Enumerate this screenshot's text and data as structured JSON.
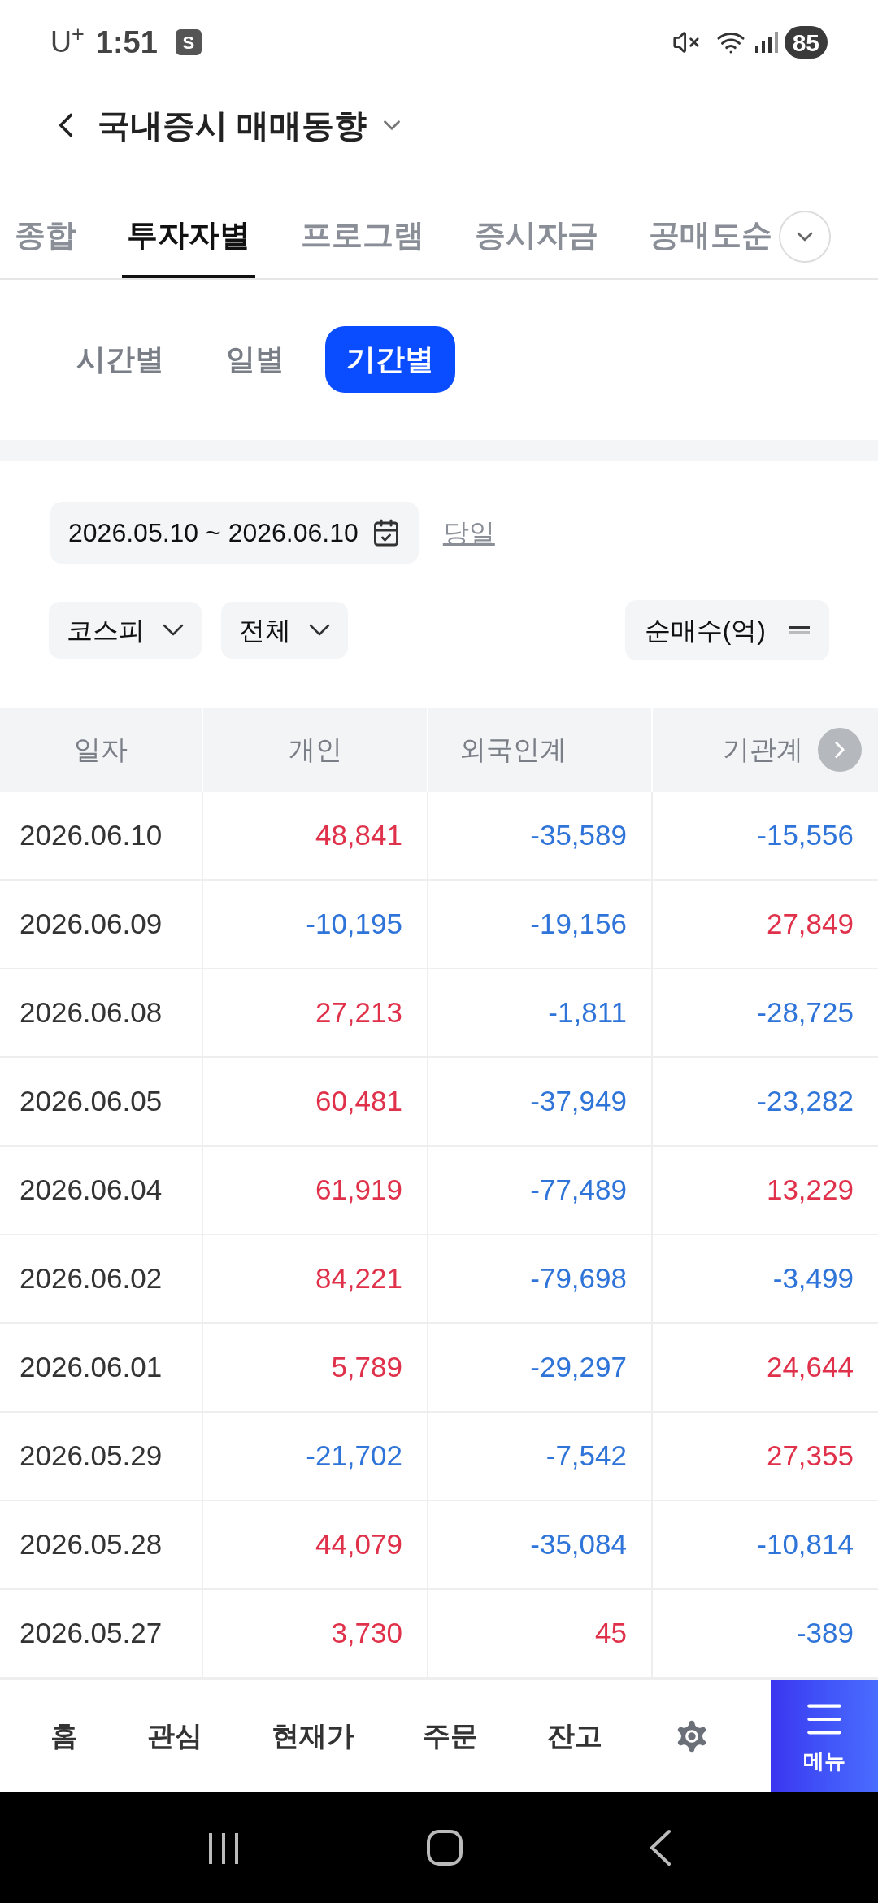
{
  "status_bar": {
    "carrier": "U$^{+}$",
    "time": "1:51",
    "notification_badge": "S",
    "battery": "85"
  },
  "header": {
    "title": "국내증시 매매동향"
  },
  "tabs": [
    {
      "label": "종합",
      "selected": false
    },
    {
      "label": "투자자별",
      "selected": true
    },
    {
      "label": "프로그램",
      "selected": false
    },
    {
      "label": "증시자금",
      "selected": false
    },
    {
      "label": "공매도순",
      "selected": false
    }
  ],
  "segments": [
    {
      "label": "시간별",
      "selected": false
    },
    {
      "label": "일별",
      "selected": false
    },
    {
      "label": "기간별",
      "selected": true
    }
  ],
  "date_range": "2026.05.10 ~ 2026.06.10",
  "today_link": "당일",
  "filters": [
    {
      "label": "코스피"
    },
    {
      "label": "전체"
    }
  ],
  "unit_selector": "순매수(억)",
  "table": {
    "columns": [
      "일자",
      "개인",
      "외국인계",
      "기관계"
    ],
    "rows": [
      [
        {
          "value": "2026.06.10"
        },
        {
          "value": "48,841",
          "color": "#e0314b"
        },
        {
          "value": "-35,589",
          "color": "#2f74d8"
        },
        {
          "value": "-15,556",
          "color": "#2f74d8"
        }
      ],
      [
        {
          "value": "2026.06.09"
        },
        {
          "value": "-10,195",
          "color": "#2f74d8"
        },
        {
          "value": "-19,156",
          "color": "#2f74d8"
        },
        {
          "value": "27,849",
          "color": "#e0314b"
        }
      ],
      [
        {
          "value": "2026.06.08"
        },
        {
          "value": "27,213",
          "color": "#e0314b"
        },
        {
          "value": "-1,811",
          "color": "#2f74d8"
        },
        {
          "value": "-28,725",
          "color": "#2f74d8"
        }
      ],
      [
        {
          "value": "2026.06.05"
        },
        {
          "value": "60,481",
          "color": "#e0314b"
        },
        {
          "value": "-37,949",
          "color": "#2f74d8"
        },
        {
          "value": "-23,282",
          "color": "#2f74d8"
        }
      ],
      [
        {
          "value": "2026.06.04"
        },
        {
          "value": "61,919",
          "color": "#e0314b"
        },
        {
          "value": "-77,489",
          "color": "#2f74d8"
        },
        {
          "value": "13,229",
          "color": "#e0314b"
        }
      ],
      [
        {
          "value": "2026.06.02"
        },
        {
          "value": "84,221",
          "color": "#e0314b"
        },
        {
          "value": "-79,698",
          "color": "#2f74d8"
        },
        {
          "value": "-3,499",
          "color": "#2f74d8"
        }
      ],
      [
        {
          "value": "2026.06.01"
        },
        {
          "value": "5,789",
          "color": "#e0314b"
        },
        {
          "value": "-29,297",
          "color": "#2f74d8"
        },
        {
          "value": "24,644",
          "color": "#e0314b"
        }
      ],
      [
        {
          "value": "2026.05.29"
        },
        {
          "value": "-21,702",
          "color": "#2f74d8"
        },
        {
          "value": "-7,542",
          "color": "#2f74d8"
        },
        {
          "value": "27,355",
          "color": "#e0314b"
        }
      ],
      [
        {
          "value": "2026.05.28"
        },
        {
          "value": "44,079",
          "color": "#e0314b"
        },
        {
          "value": "-35,084",
          "color": "#2f74d8"
        },
        {
          "value": "-10,814",
          "color": "#2f74d8"
        }
      ],
      [
        {
          "value": "2026.05.27"
        },
        {
          "value": "3,730",
          "color": "#e0314b"
        },
        {
          "value": "45",
          "color": "#e0314b"
        },
        {
          "value": "-389",
          "color": "#2f74d8"
        }
      ]
    ]
  },
  "bottom_nav": [
    {
      "kind": "text",
      "label": "홈"
    },
    {
      "kind": "text",
      "label": "관심"
    },
    {
      "kind": "text",
      "label": "현재가"
    },
    {
      "kind": "text",
      "label": "주문"
    },
    {
      "kind": "text",
      "label": "잔고"
    },
    {
      "kind": "settings"
    }
  ],
  "menu_button": "메뉴"
}
